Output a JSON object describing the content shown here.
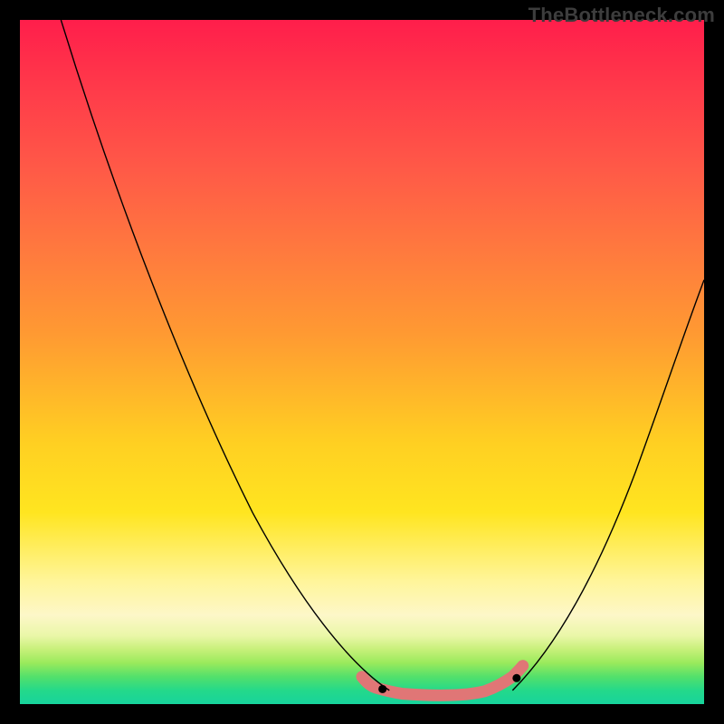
{
  "watermark": "TheBottleneck.com",
  "chart_data": {
    "type": "line",
    "title": "",
    "xlabel": "",
    "ylabel": "",
    "xlim": [
      0,
      100
    ],
    "ylim": [
      0,
      100
    ],
    "grid": false,
    "legend": false,
    "series": [
      {
        "name": "curve-left",
        "x": [
          6,
          12,
          18,
          24,
          30,
          36,
          42,
          47,
          51,
          54
        ],
        "y": [
          100,
          82,
          65,
          49,
          34,
          22,
          12,
          6,
          3,
          2
        ],
        "stroke": "#000000",
        "width": 1.2
      },
      {
        "name": "curve-right",
        "x": [
          72,
          76,
          80,
          84,
          88,
          92,
          96,
          100
        ],
        "y": [
          2,
          6,
          12,
          20,
          30,
          41,
          52,
          62
        ],
        "stroke": "#000000",
        "width": 1.2
      },
      {
        "name": "bottom-band",
        "x": [
          50,
          52,
          54,
          56,
          58,
          60,
          62,
          64,
          66,
          68,
          70,
          72,
          73
        ],
        "y": [
          4,
          2.5,
          1.8,
          1.5,
          1.3,
          1.3,
          1.3,
          1.4,
          1.6,
          2.0,
          2.8,
          4.2,
          5.2
        ],
        "stroke": "#e17878",
        "width": 10
      }
    ],
    "annotations": [
      {
        "text": "TheBottleneck.com",
        "role": "watermark"
      }
    ]
  },
  "colors": {
    "background": "#000000",
    "watermark": "#3d3d3d",
    "curve": "#000000",
    "band": "#e17878"
  }
}
